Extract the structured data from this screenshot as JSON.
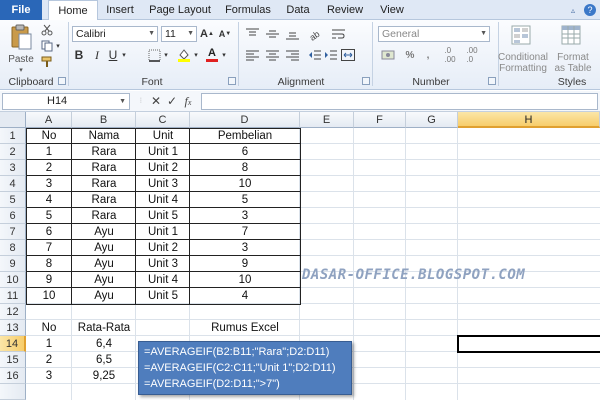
{
  "tabs": {
    "file": "File",
    "items": [
      "Home",
      "Insert",
      "Page Layout",
      "Formulas",
      "Data",
      "Review",
      "View"
    ],
    "active": "Home"
  },
  "ribbon": {
    "clipboard": {
      "paste": "Paste",
      "label": "Clipboard"
    },
    "font": {
      "name": "Calibri",
      "size": "11",
      "label": "Font"
    },
    "alignment": {
      "label": "Alignment"
    },
    "number": {
      "format": "General",
      "label": "Number"
    },
    "styles": {
      "conditional": "Conditional Formatting",
      "format_table": "Format as Table",
      "label": "Styles"
    }
  },
  "formula_bar": {
    "name_box": "H14",
    "formula": ""
  },
  "columns": [
    "A",
    "B",
    "C",
    "D",
    "E",
    "F",
    "G",
    "H"
  ],
  "selected_column": "H",
  "rows": [
    "1",
    "2",
    "3",
    "4",
    "5",
    "6",
    "7",
    "8",
    "9",
    "10",
    "11",
    "12",
    "13",
    "14",
    "15",
    "16"
  ],
  "selected_row": "14",
  "table1": {
    "headers": [
      "No",
      "Nama",
      "Unit",
      "Pembelian"
    ],
    "rows": [
      [
        "1",
        "Rara",
        "Unit 1",
        "6"
      ],
      [
        "2",
        "Rara",
        "Unit 2",
        "8"
      ],
      [
        "3",
        "Rara",
        "Unit 3",
        "10"
      ],
      [
        "4",
        "Rara",
        "Unit 4",
        "5"
      ],
      [
        "5",
        "Rara",
        "Unit 5",
        "3"
      ],
      [
        "6",
        "Ayu",
        "Unit 1",
        "7"
      ],
      [
        "7",
        "Ayu",
        "Unit 2",
        "3"
      ],
      [
        "8",
        "Ayu",
        "Unit 3",
        "9"
      ],
      [
        "9",
        "Ayu",
        "Unit 4",
        "10"
      ],
      [
        "10",
        "Ayu",
        "Unit 5",
        "4"
      ]
    ]
  },
  "table2": {
    "headers": [
      "No",
      "Rata-Rata",
      "Rumus Excel"
    ],
    "rows": [
      [
        "1",
        "6,4"
      ],
      [
        "2",
        "6,5"
      ],
      [
        "3",
        "9,25"
      ]
    ]
  },
  "formulas": [
    "=AVERAGEIF(B2:B11;\"Rara\";D2:D11)",
    "=AVERAGEIF(C2:C11;\"Unit 1\";D2:D11)",
    "=AVERAGEIF(D2:D11;\">7\")"
  ],
  "watermark": "DASAR-OFFICE.BLOGSPOT.COM"
}
